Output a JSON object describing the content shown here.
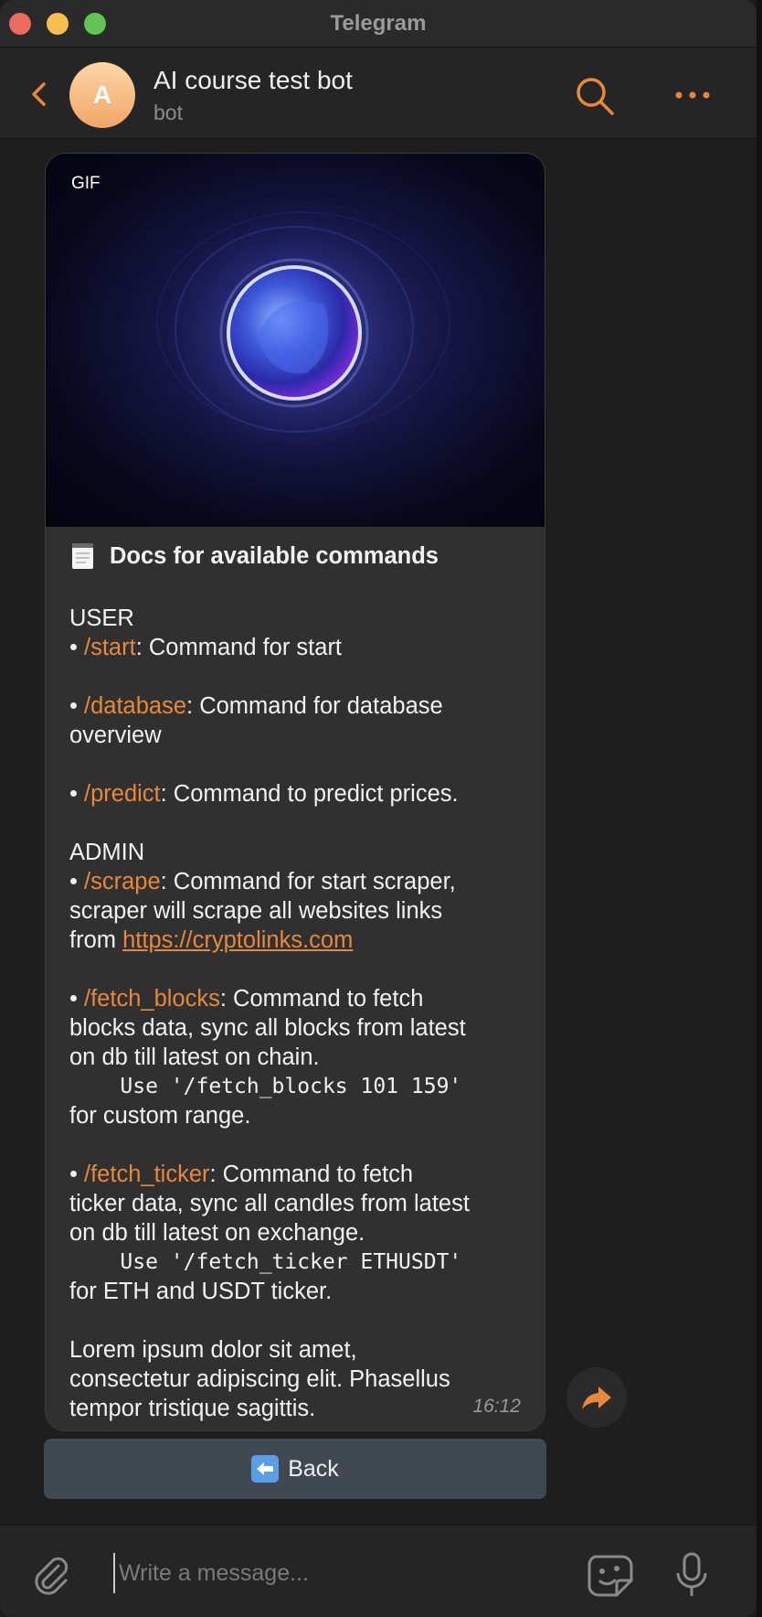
{
  "window": {
    "title": "Telegram"
  },
  "chat_header": {
    "avatar_letter": "A",
    "title": "AI course test bot",
    "subtitle": "bot",
    "accent_color": "#e8883a"
  },
  "message": {
    "gif_badge": "GIF",
    "heading": "Docs for available commands",
    "user_section": "USER",
    "bullet": "• ",
    "cmd_start": "/start",
    "cmd_start_desc": ": Command for start",
    "cmd_database": "/database",
    "cmd_database_desc_1": ": Command for database",
    "cmd_database_desc_2": "overview",
    "cmd_predict": "/predict",
    "cmd_predict_desc": ": Command to predict prices.",
    "admin_section": "ADMIN",
    "cmd_scrape": "/scrape",
    "cmd_scrape_desc_1": ": Command for start scraper,",
    "cmd_scrape_desc_2": "scraper will scrape all websites links",
    "cmd_scrape_desc_3": "from ",
    "scrape_link": "https://cryptolinks.com",
    "cmd_fetch_blocks": "/fetch_blocks",
    "cmd_fetch_blocks_desc_1": ": Command to fetch",
    "cmd_fetch_blocks_desc_2": "blocks data, sync all blocks from latest",
    "cmd_fetch_blocks_desc_3": "on db till latest on chain.",
    "cmd_fetch_blocks_usage": "    Use '/fetch_blocks 101 159'",
    "cmd_fetch_blocks_desc_4": "for custom range.",
    "cmd_fetch_ticker": "/fetch_ticker",
    "cmd_fetch_ticker_desc_1": ": Command to fetch",
    "cmd_fetch_ticker_desc_2": "ticker data, sync all candles from latest",
    "cmd_fetch_ticker_desc_3": "on db till latest on exchange.",
    "cmd_fetch_ticker_usage": "    Use '/fetch_ticker ETHUSDT'",
    "cmd_fetch_ticker_desc_4": "for ETH and USDT ticker.",
    "lorem_1": "Lorem ipsum dolor sit amet,",
    "lorem_2": "consectetur adipiscing elit. Phasellus",
    "lorem_3": "tempor tristique sagittis.",
    "time": "16:12"
  },
  "keyboard": {
    "back_label": "Back"
  },
  "composer": {
    "placeholder": "Write a message..."
  }
}
